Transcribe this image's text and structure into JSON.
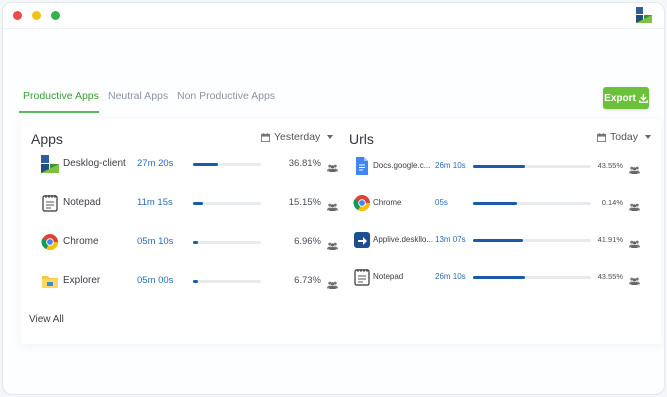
{
  "window": {
    "dots": [
      "close",
      "minimize",
      "maximize"
    ]
  },
  "tabs": [
    {
      "label": "Productive Apps",
      "active": true
    },
    {
      "label": "Neutral Apps",
      "active": false
    },
    {
      "label": "Non Productive Apps",
      "active": false
    }
  ],
  "export": {
    "label": "Export",
    "icon": "download-icon"
  },
  "apps": {
    "title": "Apps",
    "date_filter": "Yesterday",
    "items": [
      {
        "name": "Desklog-client",
        "time": "27m 20s",
        "pct": "36.81%",
        "fill": 0.37,
        "icon": "desklog-icon"
      },
      {
        "name": "Notepad",
        "time": "11m 15s",
        "pct": "15.15%",
        "fill": 0.15,
        "icon": "notepad-icon"
      },
      {
        "name": "Chrome",
        "time": "05m 10s",
        "pct": "6.96%",
        "fill": 0.07,
        "icon": "chrome-icon"
      },
      {
        "name": "Explorer",
        "time": "05m 00s",
        "pct": "6.73%",
        "fill": 0.07,
        "icon": "explorer-icon"
      }
    ],
    "view_all": "View All"
  },
  "urls": {
    "title": "Urls",
    "date_filter": "Today",
    "items": [
      {
        "name": "Docs.google.c...",
        "time": "26m 10s",
        "pct": "43.55%",
        "fill": 0.44,
        "icon": "google-docs-icon"
      },
      {
        "name": "Chrome",
        "time": "05s",
        "pct": "0.14%",
        "fill": 0.37,
        "icon": "chrome-icon"
      },
      {
        "name": "Applive.deskllo...",
        "time": "13m 07s",
        "pct": "41.91%",
        "fill": 0.42,
        "icon": "applive-icon"
      },
      {
        "name": "Notepad",
        "time": "26m 10s",
        "pct": "43.55%",
        "fill": 0.44,
        "icon": "notepad-icon"
      }
    ]
  },
  "colors": {
    "accent": "#5cb85c",
    "bar": "#1b5aa6",
    "time_text": "#2a6db5"
  }
}
